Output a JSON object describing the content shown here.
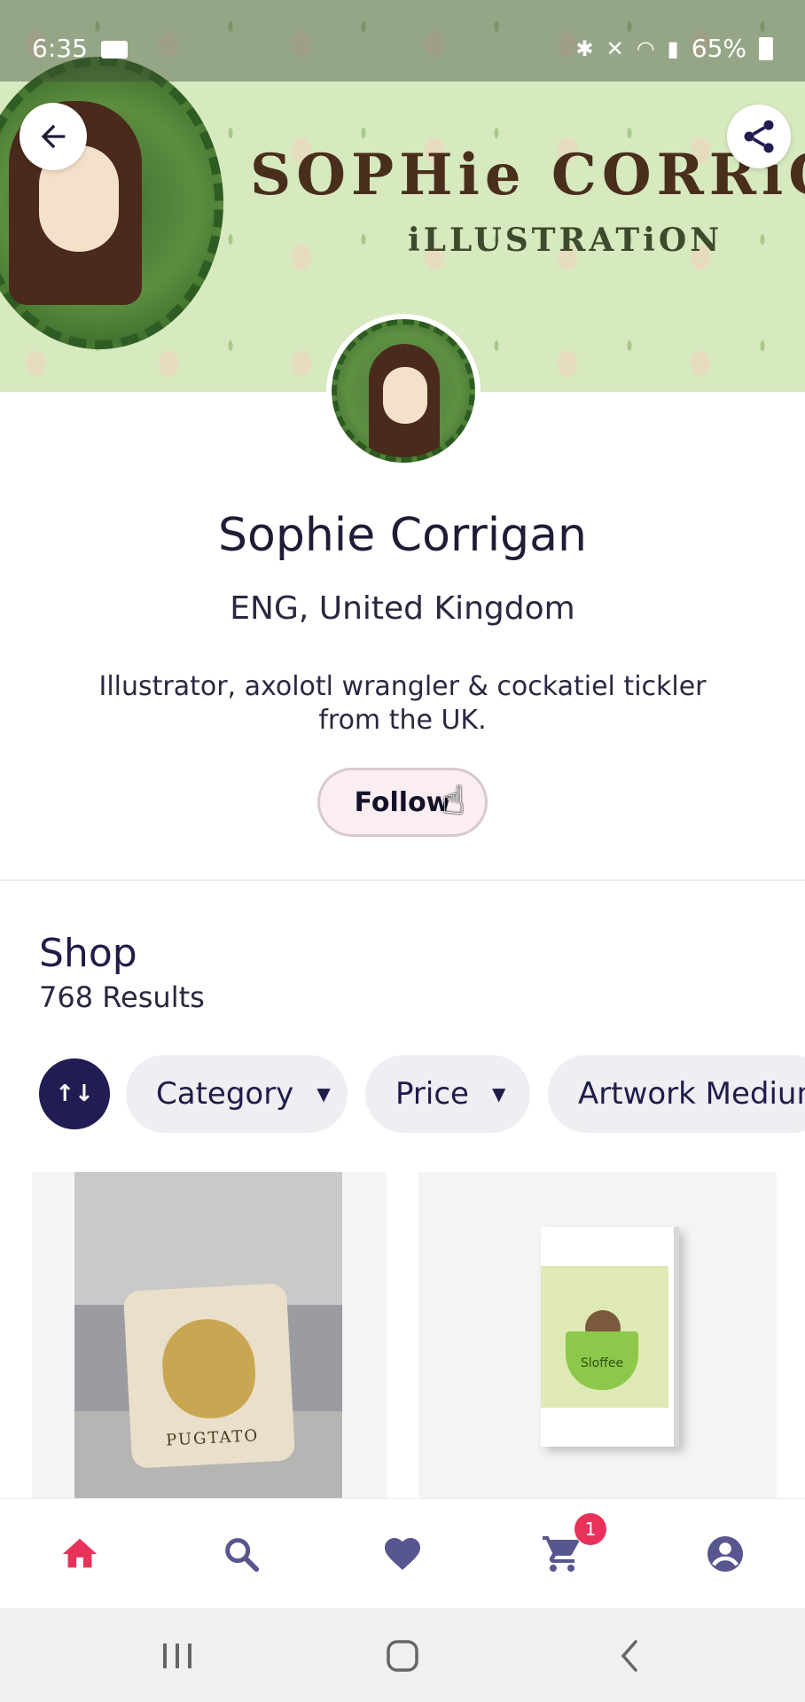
{
  "status_bar": {
    "time": "6:35",
    "battery": "65%"
  },
  "banner": {
    "title": "SOPHie CORRiGA",
    "subtitle": "iLLUSTRATiON"
  },
  "profile": {
    "name": "Sophie Corrigan",
    "location": "ENG, United Kingdom",
    "bio": "Illustrator, axolotl wrangler & cockatiel tickler from the UK.",
    "follow_label": "Follow"
  },
  "shop": {
    "title": "Shop",
    "results": "768 Results",
    "filters": {
      "category": "Category",
      "price": "Price",
      "medium": "Artwork Medium"
    },
    "products": [
      {
        "art_text": "PUGTATO",
        "icon": "pillow-image"
      },
      {
        "art_text": "Sloffee",
        "icon": "greeting-card-image"
      }
    ]
  },
  "bottom_nav": {
    "cart_count": "1",
    "active_color": "#e8325a",
    "icon_color": "#58568f"
  },
  "colors": {
    "brand_dark": "#211c53",
    "accent": "#e8325a",
    "chip_bg": "#eeeef3"
  }
}
